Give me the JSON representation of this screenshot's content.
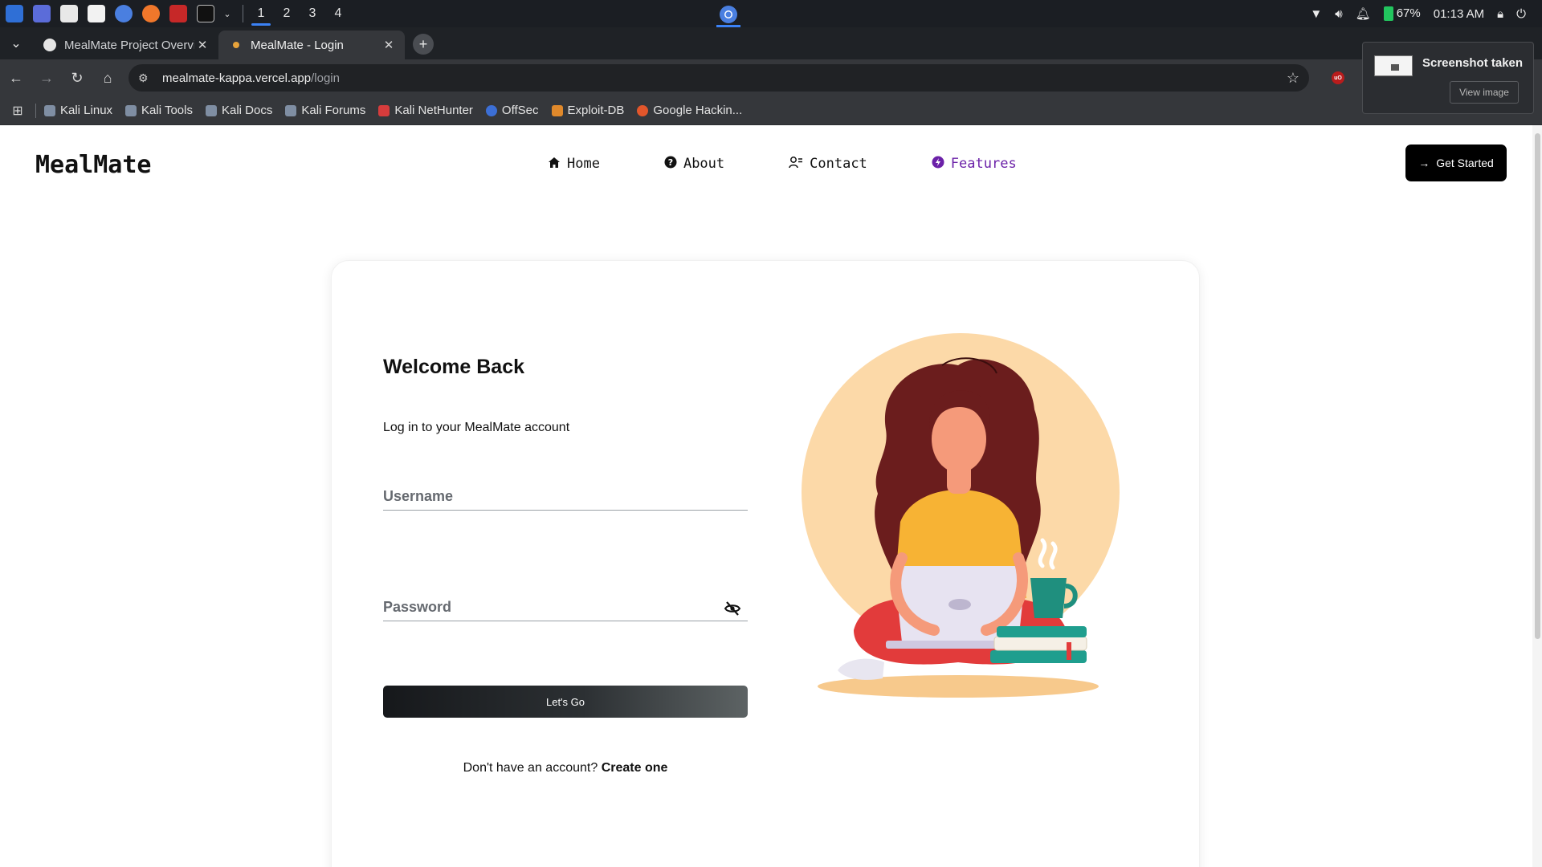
{
  "os": {
    "workspaces": [
      "1",
      "2",
      "3",
      "4"
    ],
    "active_workspace": "1",
    "battery": "67%",
    "clock": "01:13 AM"
  },
  "browser": {
    "tabs": [
      {
        "title": "MealMate Project Overvi",
        "active": false
      },
      {
        "title": "MealMate - Login",
        "active": true
      }
    ],
    "address": {
      "host": "mealmate-kappa.vercel.app",
      "path": "/login"
    },
    "bookmarks": [
      "Kali Linux",
      "Kali Tools",
      "Kali Docs",
      "Kali Forums",
      "Kali NetHunter",
      "OffSec",
      "Exploit-DB",
      "Google Hackin..."
    ]
  },
  "notification": {
    "title": "Screenshot taken",
    "action": "View image"
  },
  "site": {
    "logo": "MealMate",
    "nav": [
      {
        "label": "Home",
        "icon": "home-icon"
      },
      {
        "label": "About",
        "icon": "question-circle-icon"
      },
      {
        "label": "Contact",
        "icon": "contact-icon"
      },
      {
        "label": "Features",
        "icon": "features-icon"
      }
    ],
    "cta": "Get Started"
  },
  "login": {
    "heading": "Welcome Back",
    "subtitle": "Log in to your MealMate account",
    "username_placeholder": "Username",
    "password_placeholder": "Password",
    "submit": "Let's Go",
    "signup_prompt": "Don't have an account?",
    "signup_link": "Create one"
  },
  "colors": {
    "accent_nav": "#6b21a8",
    "cta_bg": "#000000",
    "illustration_circle": "#fcd9a8"
  }
}
